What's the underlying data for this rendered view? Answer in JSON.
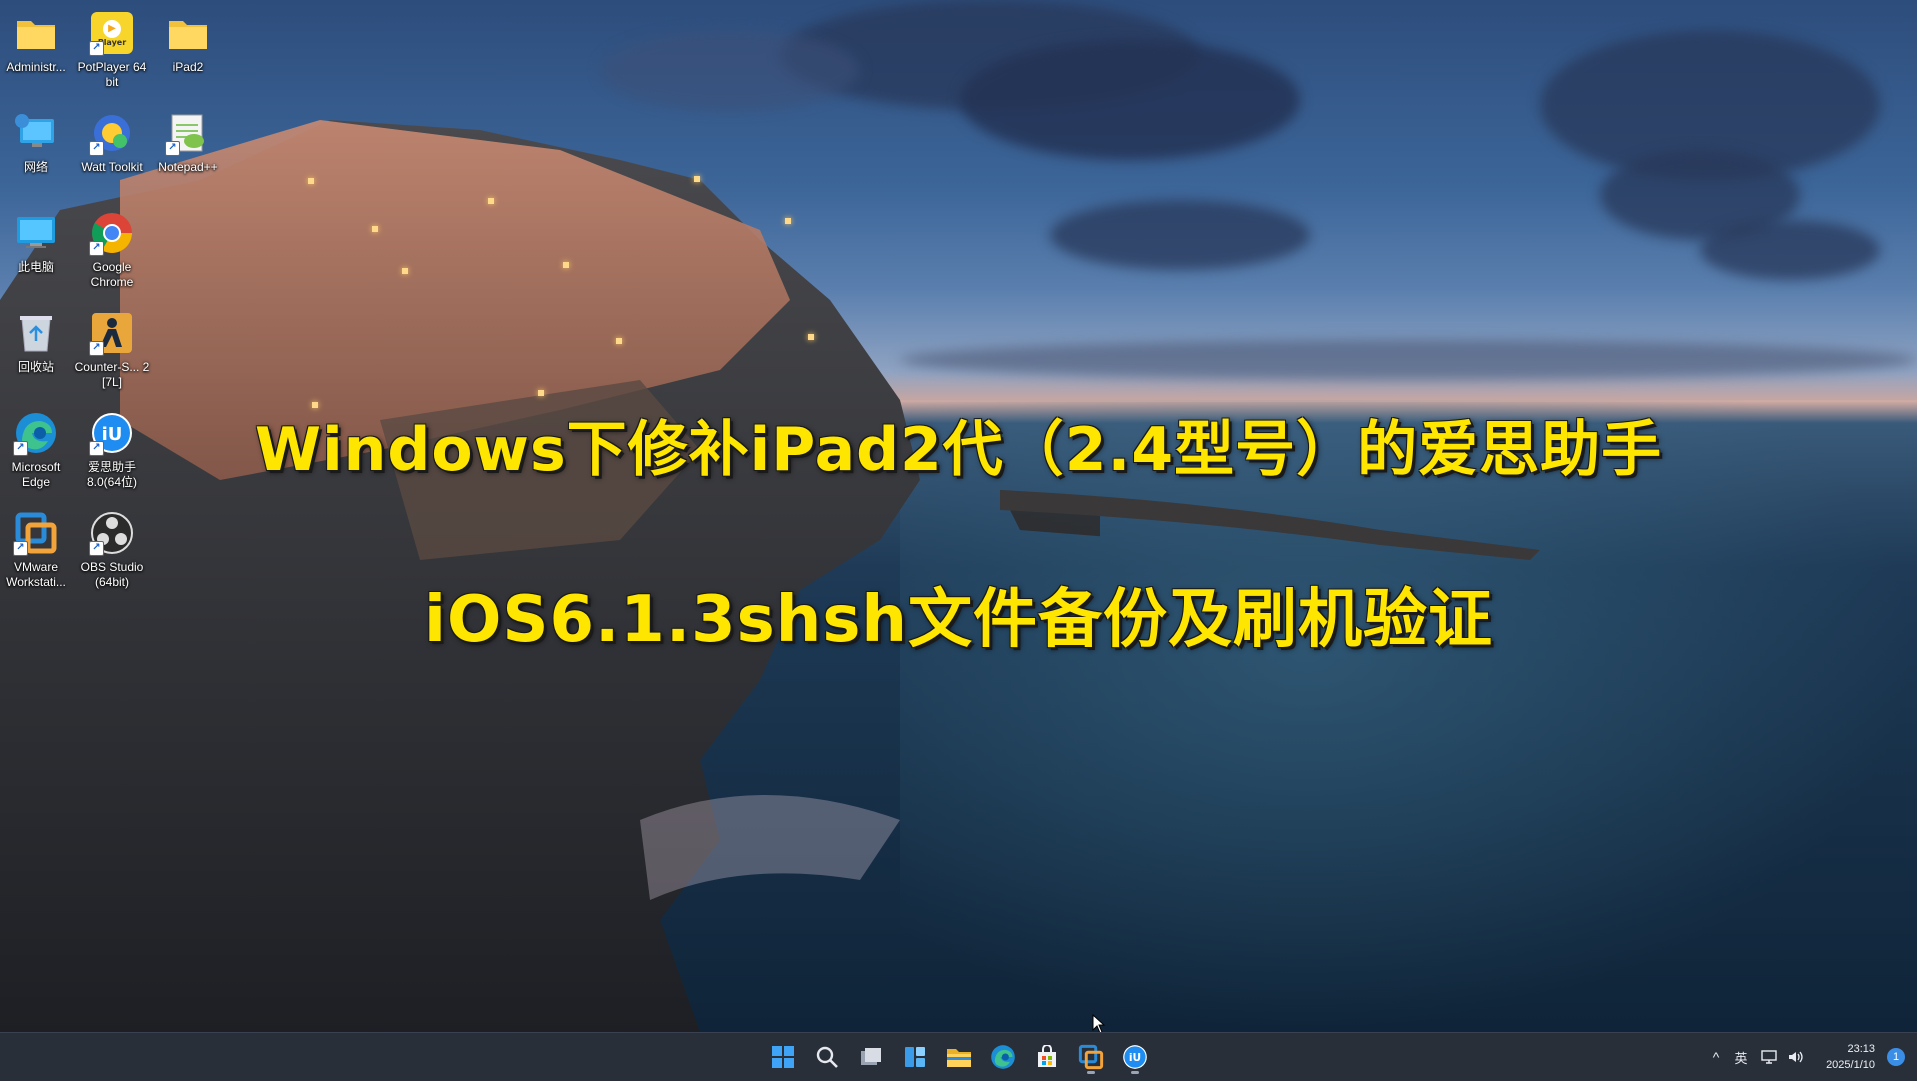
{
  "desktop": {
    "icons": [
      {
        "label": "Administr...",
        "icon": "folder-icon"
      },
      {
        "label": "PotPlayer 64 bit",
        "icon": "potplayer-icon",
        "badge": "Player"
      },
      {
        "label": "iPad2",
        "icon": "folder-icon"
      },
      {
        "label": "网络",
        "icon": "network-icon"
      },
      {
        "label": "Watt Toolkit",
        "icon": "watt-toolkit-icon"
      },
      {
        "label": "Notepad++",
        "icon": "notepad-plus-plus-icon"
      },
      {
        "label": "此电脑",
        "icon": "this-pc-icon"
      },
      {
        "label": "Google Chrome",
        "icon": "chrome-icon"
      },
      {
        "label": "回收站",
        "icon": "recycle-bin-icon"
      },
      {
        "label": "Counter-S... 2 [7L]",
        "icon": "counter-strike-icon"
      },
      {
        "label": "Microsoft Edge",
        "icon": "edge-icon"
      },
      {
        "label": "爱思助手 8.0(64位)",
        "icon": "i4-assistant-icon"
      },
      {
        "label": "VMware Workstati...",
        "icon": "vmware-icon"
      },
      {
        "label": "OBS Studio (64bit)",
        "icon": "obs-icon"
      }
    ]
  },
  "overlay": {
    "line1": "Windows下修补iPad2代（2.4型号）的爱思助手",
    "line2": "iOS6.1.3shsh文件备份及刷机验证"
  },
  "taskbar": {
    "apps": [
      {
        "name": "start-button",
        "icon": "windows-logo-icon",
        "running": false
      },
      {
        "name": "search-button",
        "icon": "search-icon",
        "running": false
      },
      {
        "name": "task-view-button",
        "icon": "task-view-icon",
        "running": false
      },
      {
        "name": "widgets-button",
        "icon": "widgets-icon",
        "running": false
      },
      {
        "name": "file-explorer-button",
        "icon": "folder-icon",
        "running": false
      },
      {
        "name": "edge-button",
        "icon": "edge-icon",
        "running": false
      },
      {
        "name": "store-button",
        "icon": "store-icon",
        "running": false
      },
      {
        "name": "vmware-button",
        "icon": "vmware-icon",
        "running": true
      },
      {
        "name": "i4-assistant-button",
        "icon": "i4-assistant-icon",
        "running": true
      }
    ],
    "tray": {
      "chevron": "^",
      "ime": "英",
      "time": "23:13",
      "date": "2025/1/10",
      "notifications": "1"
    }
  },
  "colors": {
    "title_text": "#ffe600",
    "taskbar_bg": "#20262f",
    "accent": "#3a8ee6"
  }
}
